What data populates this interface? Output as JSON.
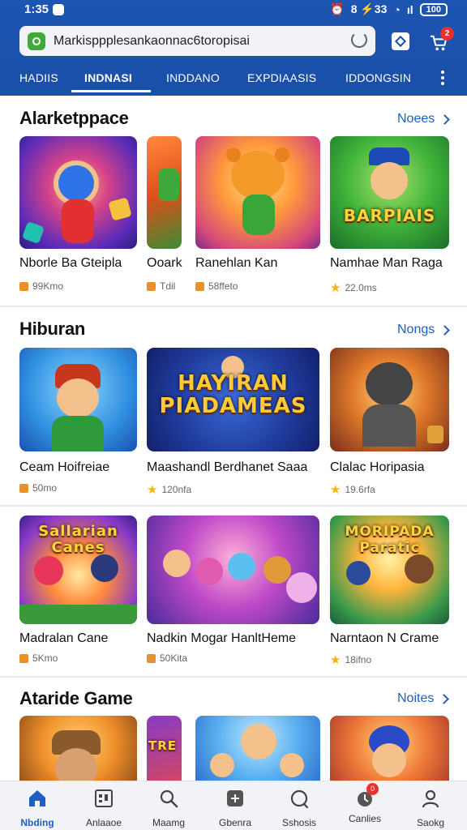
{
  "status_bar": {
    "time": "1:35",
    "right_text": "8 ⚡33",
    "battery": "100"
  },
  "address_bar": {
    "url": "Markisppplesankaonnac6toropisai"
  },
  "header": {
    "cart_badge": "2"
  },
  "tabs": [
    {
      "label": "HADIIS",
      "active": false
    },
    {
      "label": "INDNASI",
      "active": true
    },
    {
      "label": "INDDANO",
      "active": false
    },
    {
      "label": "EXPDIAASIS",
      "active": false
    },
    {
      "label": "IDDONGSIN",
      "active": false
    }
  ],
  "sections": [
    {
      "title": "Alarketppace",
      "more_label": "Noees",
      "cards": [
        {
          "title": "Nborle Ba Gteipla",
          "meta": "99Kmo",
          "meta_icon": "flag-icon"
        },
        {
          "title": "Ooark",
          "meta": "Tdil",
          "meta_icon": "flag-icon"
        },
        {
          "title": "Ranehlan Kan",
          "meta": "58ffeto",
          "meta_icon": "flag-icon"
        },
        {
          "title": "Namhae Man Raga",
          "meta": "22.0ms",
          "meta_icon": "star-icon",
          "thumb_text": "BARPIAIS"
        }
      ]
    },
    {
      "title": "Hiburan",
      "more_label": "Nongs",
      "cards": [
        {
          "title": "Ceam Hoifreiae",
          "meta": "50mo",
          "meta_icon": "flag-icon"
        },
        {
          "title": "Maashandl Berdhanet Saaa",
          "meta": "120nfa",
          "meta_icon": "star-icon",
          "thumb_text": "HAYIRAN PIADAMEAS"
        },
        {
          "title": "Clalac Horipasia",
          "meta": "19.6rfa",
          "meta_icon": "star-icon"
        }
      ]
    },
    {
      "title": "",
      "more_label": "",
      "cards": [
        {
          "title": "Madralan Cane",
          "meta": "5Kmo",
          "meta_icon": "flag-icon",
          "thumb_text": "Sallarian Canes"
        },
        {
          "title": "Nadkin Mogar HanltHeme",
          "meta": "50Kita",
          "meta_icon": "flag-icon"
        },
        {
          "title": "Narntaon N Crame",
          "meta": "18ifno",
          "meta_icon": "star-icon",
          "thumb_text": "MORIPADA Paratic"
        }
      ]
    },
    {
      "title": "Ataride Game",
      "more_label": "Noites",
      "cards": [
        {
          "title": "",
          "meta": ""
        },
        {
          "title": "",
          "meta": "",
          "thumb_text": "TRE"
        },
        {
          "title": "",
          "meta": ""
        },
        {
          "title": "",
          "meta": ""
        }
      ]
    }
  ],
  "bottom_nav": [
    {
      "label": "Nbding",
      "icon": "home-icon",
      "active": true
    },
    {
      "label": "Anlaaoe",
      "icon": "grid-icon",
      "active": false
    },
    {
      "label": "Maamg",
      "icon": "search-icon",
      "active": false
    },
    {
      "label": "Gbenra",
      "icon": "apps-icon",
      "active": false
    },
    {
      "label": "Sshosis",
      "icon": "circle-icon",
      "active": false
    },
    {
      "label": "Canlies",
      "icon": "bell-icon",
      "active": false,
      "badge": "0"
    },
    {
      "label": "Saokg",
      "icon": "profile-icon",
      "active": false
    }
  ],
  "colors": {
    "brand": "#1a4fa8",
    "link": "#1f5fc4",
    "badge": "#e4312f",
    "star": "#f4b400"
  }
}
